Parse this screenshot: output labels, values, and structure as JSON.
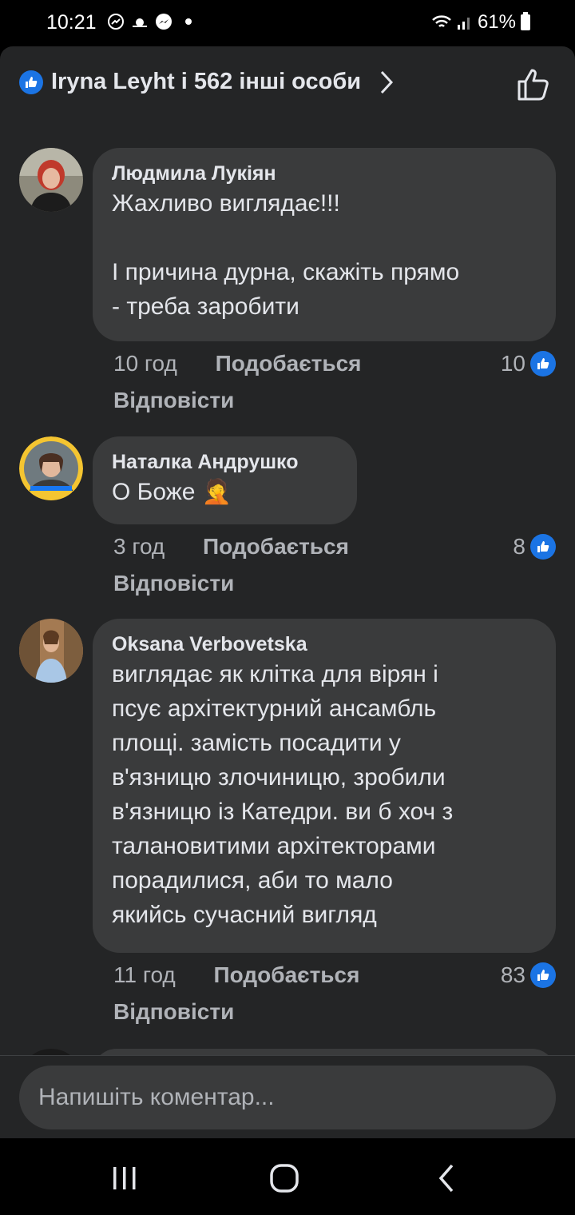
{
  "status_bar": {
    "time": "10:21",
    "battery": "61%",
    "icons": [
      "messenger-bubble-icon",
      "weather-icon",
      "messenger-icon",
      "notification-dot",
      "wifi-icon",
      "signal-icon",
      "battery-icon"
    ]
  },
  "header": {
    "reactors": "Iryna Leyht і 562 інші особи"
  },
  "comments": [
    {
      "author": "Людмила Лукіян",
      "text": "Жахливо виглядає!!!\n\nІ причина дурна, скажіть прямо\n- треба заробити",
      "time": "10 год",
      "like_label": "Подобається",
      "reply_label": "Відповісти",
      "likes": "10"
    },
    {
      "author": "Наталка Андрушко",
      "text": "О Боже 🤦",
      "time": "3 год",
      "like_label": "Подобається",
      "reply_label": "Відповісти",
      "likes": "8"
    },
    {
      "author": "Oksana Verbovetska",
      "text": "виглядає як клітка для вірян і\nпсує архітектурний ансамбль\nплощі. замість посадити у\nв'язницю злочиницю, зробили\nв'язницю із Катедри. ви б хоч з\nталановитими архітекторами\nпорадилися, аби то мало\nякийсь сучасний вигляд",
      "time": "11 год",
      "like_label": "Подобається",
      "reply_label": "Відповісти",
      "likes": "83"
    }
  ],
  "composer": {
    "placeholder": "Напишіть коментар..."
  },
  "colors": {
    "accent": "#1b74e4",
    "background": "#242526",
    "bubble": "#3a3b3c",
    "secondary_text": "#b0b3b8"
  }
}
